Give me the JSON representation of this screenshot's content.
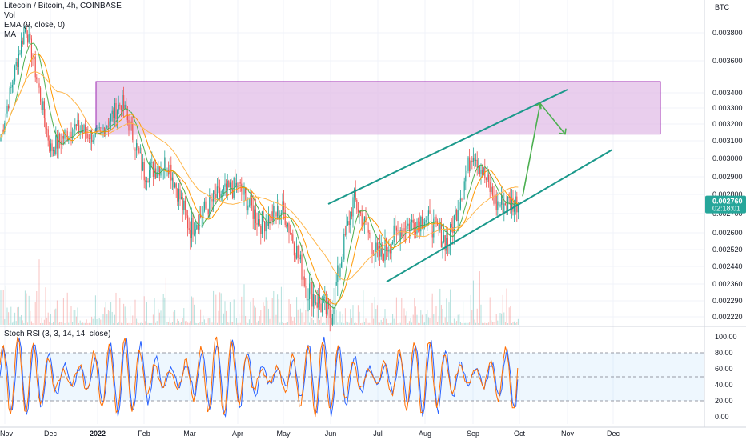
{
  "legend": {
    "symbol": "Litecoin / Bitcoin, 4h, COINBASE",
    "vol": "Vol",
    "ema": "EMA (9, close, 0)",
    "ma": "MA"
  },
  "rsi_legend": "Stoch RSI (3, 3, 14, 14, close)",
  "price_axis": {
    "currency": "BTC",
    "last_price": "0.002760",
    "countdown": "02:18:01",
    "badge_color": "#26a69a"
  },
  "colors": {
    "zone_fill": "#e1bee7",
    "zone_stroke": "#9c27b0",
    "channel": "#1b998b",
    "projection": "#4caf50",
    "candle_up": "#26a69a",
    "candle_down": "#ef5350",
    "ema": "#ff9800",
    "ma_fast": "#4caf50",
    "ma_slow": "#ffb74d",
    "rsi_k": "#2962ff",
    "rsi_d": "#ff6d00"
  },
  "chart_data": [
    {
      "type": "candlestick",
      "title": "Litecoin / Bitcoin, 4h, COINBASE",
      "ylabel": "BTC",
      "ylim": [
        0.00219,
        0.0039
      ],
      "y_ticks": [
        "0.003800",
        "0.003600",
        "0.003400",
        "0.003300",
        "0.003200",
        "0.003100",
        "0.003000",
        "0.002900",
        "0.002800",
        "0.002700",
        "0.002600",
        "0.002520",
        "0.002440",
        "0.002360",
        "0.002290",
        "0.002220"
      ],
      "x_ticks": [
        "Nov",
        "Dec",
        "2022",
        "Feb",
        "Mar",
        "Apr",
        "May",
        "Jun",
        "Jul",
        "Aug",
        "Sep",
        "Oct",
        "Nov",
        "Dec"
      ],
      "series": [
        {
          "name": "Litecoin / Bitcoin",
          "x": [
            "Nov",
            "mid-Nov",
            "Dec",
            "mid-Dec",
            "2022",
            "mid-Jan",
            "Feb",
            "mid-Feb",
            "Mar",
            "mid-Mar",
            "Apr",
            "mid-Apr",
            "May",
            "mid-May",
            "Jun",
            "mid-Jun",
            "Jul",
            "mid-Jul",
            "Aug",
            "mid-Aug",
            "Sep",
            "mid-Sep",
            "Oct"
          ],
          "values": [
            0.0031,
            0.00385,
            0.00305,
            0.00318,
            0.00312,
            0.00334,
            0.00292,
            0.00298,
            0.00262,
            0.00278,
            0.00285,
            0.00265,
            0.00272,
            0.00235,
            0.00222,
            0.00278,
            0.00248,
            0.00262,
            0.00268,
            0.00255,
            0.00305,
            0.00275,
            0.00276
          ]
        }
      ],
      "last_price": 0.00276,
      "annotations": {
        "resistance_zone": [
          0.00314,
          0.00347
        ],
        "channel_upper": [
          [
            "Jun",
            0.00275
          ],
          [
            "Nov",
            0.00342
          ]
        ],
        "channel_lower": [
          [
            "Jul",
            0.00237
          ],
          [
            "Dec",
            0.00305
          ]
        ],
        "projection": [
          [
            "Oct",
            0.00279
          ],
          [
            "Oct-mid",
            0.00333
          ],
          [
            "Nov",
            0.00314
          ]
        ]
      }
    },
    {
      "type": "line",
      "title": "Stoch RSI (3, 3, 14, 14, close)",
      "ylim": [
        0,
        100
      ],
      "y_ticks": [
        "100.00",
        "80.00",
        "60.00",
        "40.00",
        "20.00",
        "0.00"
      ],
      "bands": [
        20,
        50,
        80
      ],
      "series": [
        {
          "name": "K",
          "values": [
            70,
            95,
            40,
            5,
            60,
            100,
            20,
            10,
            85,
            90,
            30,
            5,
            75,
            100,
            45,
            10,
            60,
            95,
            20,
            0,
            80,
            100,
            35,
            10,
            90,
            55,
            5,
            70
          ]
        },
        {
          "name": "D",
          "values": [
            65,
            85,
            55,
            15,
            45,
            90,
            40,
            15,
            70,
            88,
            45,
            12,
            60,
            92,
            55,
            20,
            50,
            85,
            35,
            8,
            65,
            95,
            50,
            18,
            80,
            65,
            15,
            60
          ]
        }
      ]
    }
  ]
}
